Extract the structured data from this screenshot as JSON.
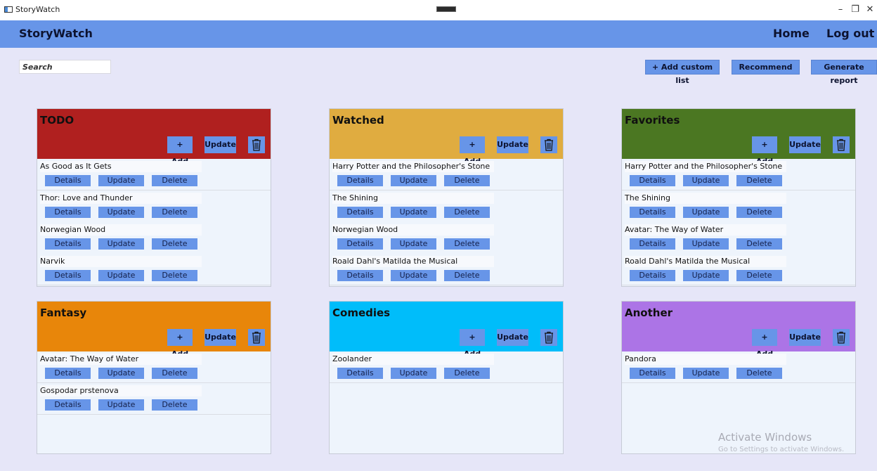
{
  "window": {
    "title": "StoryWatch"
  },
  "header": {
    "brand": "StoryWatch",
    "home": "Home",
    "logout": "Log out"
  },
  "search": {
    "placeholder": "Search"
  },
  "toolbar": {
    "add_list": "+ Add custom list",
    "recommend": "Recommend",
    "report": "Generate report"
  },
  "list_buttons": {
    "add": "+ Add",
    "update": "Update"
  },
  "item_buttons": {
    "details": "Details",
    "update": "Update",
    "delete": "Delete"
  },
  "lists": [
    {
      "title": "TODO",
      "color": "#b0201f",
      "items": [
        "As Good as It Gets",
        "Thor: Love and Thunder",
        "Norwegian Wood",
        "Narvik"
      ]
    },
    {
      "title": "Watched",
      "color": "#e0ac40",
      "items": [
        "Harry Potter and the Philosopher's Stone",
        "The Shining",
        "Norwegian Wood",
        "Roald Dahl's Matilda the Musical"
      ]
    },
    {
      "title": "Favorites",
      "color": "#4b7722",
      "items": [
        "Harry Potter and the Philosopher's Stone",
        "The Shining",
        "Avatar: The Way of Water",
        "Roald Dahl's Matilda the Musical"
      ]
    },
    {
      "title": "Fantasy",
      "color": "#e8860a",
      "items": [
        "Avatar: The Way of Water",
        "Gospodar prstenova"
      ]
    },
    {
      "title": "Comedies",
      "color": "#00bdfa",
      "items": [
        "Zoolander"
      ]
    },
    {
      "title": "Another",
      "color": "#ac74e6",
      "items": [
        "Pandora"
      ]
    }
  ],
  "watermark": {
    "line1": "Activate Windows",
    "line2": "Go to Settings to activate Windows."
  }
}
